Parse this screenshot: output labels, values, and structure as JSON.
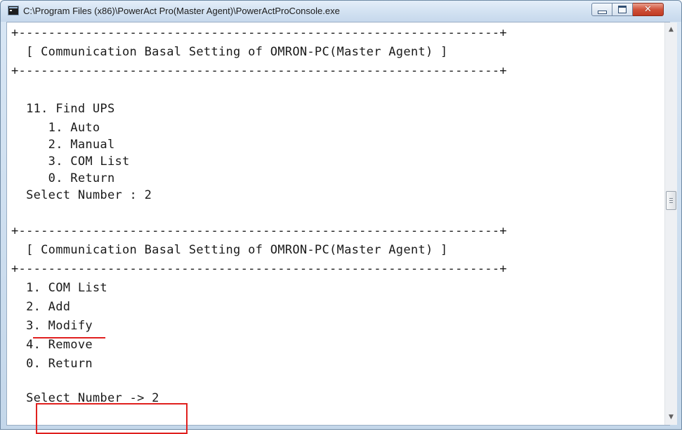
{
  "window": {
    "title": "C:\\Program Files (x86)\\PowerAct Pro(Master Agent)\\PowerActProConsole.exe",
    "controls": {
      "minimize_icon": "minimize-icon",
      "maximize_icon": "maximize-icon",
      "close_icon": "close-icon",
      "close_glyph": "✕"
    }
  },
  "console": {
    "lines": [
      "+-----------------------------------------------------------------+",
      "  [ Communication Basal Setting of OMRON-PC(Master Agent) ]",
      "+-----------------------------------------------------------------+",
      "  11. Find UPS",
      "     1. Auto",
      "     2. Manual",
      "     3. COM List",
      "     0. Return",
      "  Select Number : 2",
      "",
      "+-----------------------------------------------------------------+",
      "  [ Communication Basal Setting of OMRON-PC(Master Agent) ]",
      "+-----------------------------------------------------------------+",
      "  1. COM List",
      "  2. Add",
      "  3. Modify",
      "  4. Remove",
      "  0. Return",
      "",
      "  Select Number -> 2"
    ]
  },
  "scrollbar": {
    "up_glyph": "▲",
    "down_glyph": "▼"
  },
  "annotations": {
    "accent_color": "#e0201e"
  }
}
